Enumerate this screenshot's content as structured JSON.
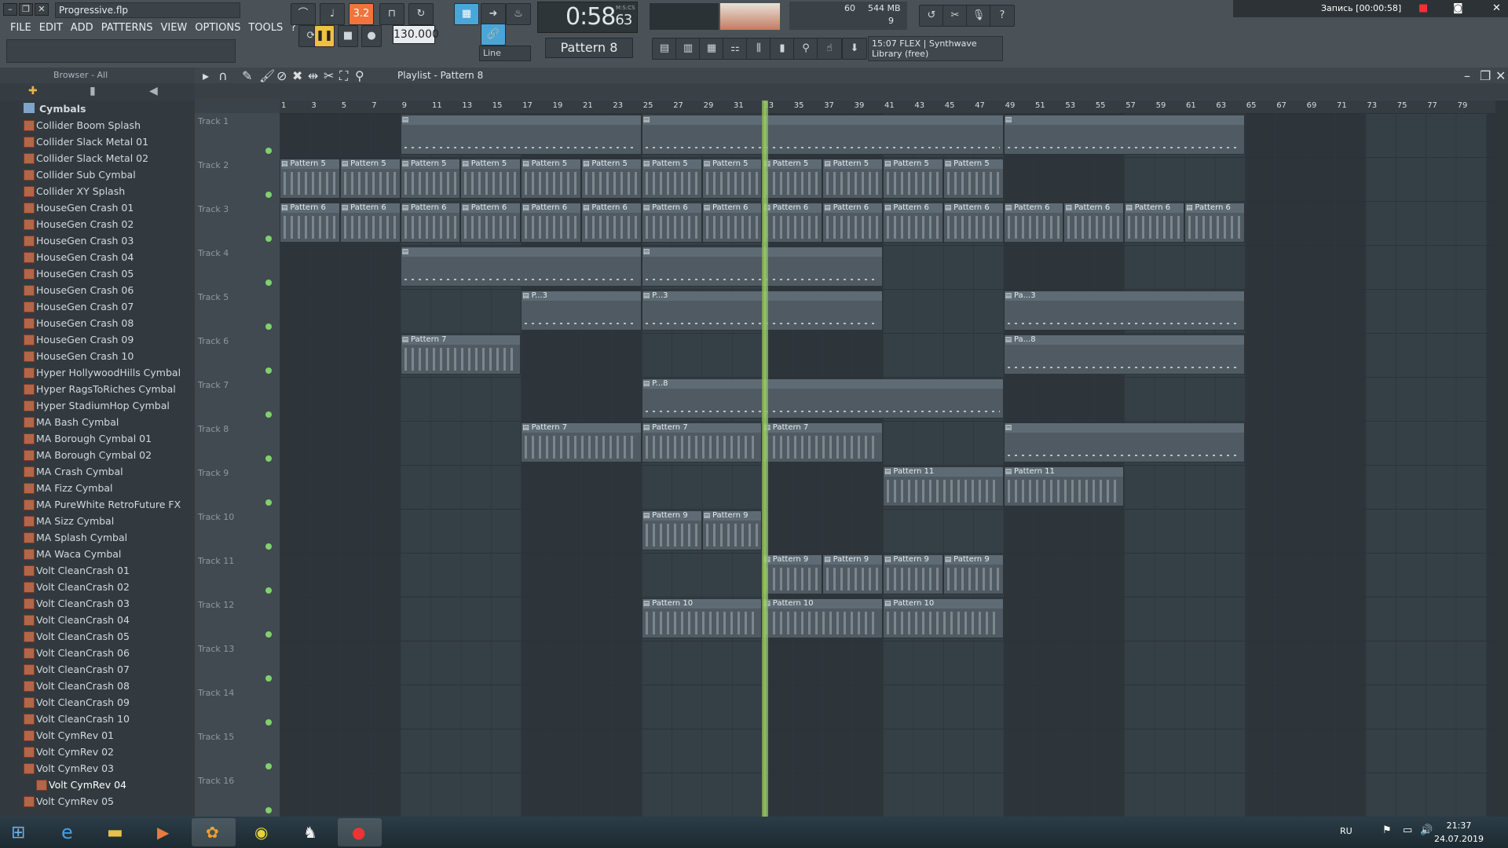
{
  "window": {
    "title": "Progressive.flp"
  },
  "menu": [
    "FILE",
    "EDIT",
    "ADD",
    "PATTERNS",
    "VIEW",
    "OPTIONS",
    "TOOLS",
    "?"
  ],
  "transport": {
    "time": "0:58",
    "time_sub": "63",
    "time_unit": "M:S:CS",
    "bpm": "130.000",
    "snap": "Line",
    "pattern": "Pattern 8",
    "step_counter": "3.2",
    "cpu_value": "60",
    "ram": "544 MB",
    "polyphony": "9"
  },
  "hint_panel": {
    "line1": "15:07  FLEX | Synthwave",
    "line2": "Library (free)"
  },
  "recording": {
    "label": "Запись [00:00:58]"
  },
  "browser": {
    "header": "Browser - All",
    "folder": "Cymbals",
    "items": [
      "Collider Boom Splash",
      "Collider Slack Metal 01",
      "Collider Slack Metal 02",
      "Collider Sub Cymbal",
      "Collider XY Splash",
      "HouseGen Crash 01",
      "HouseGen Crash 02",
      "HouseGen Crash 03",
      "HouseGen Crash 04",
      "HouseGen Crash 05",
      "HouseGen Crash 06",
      "HouseGen Crash 07",
      "HouseGen Crash 08",
      "HouseGen Crash 09",
      "HouseGen Crash 10",
      "Hyper HollywoodHills Cymbal",
      "Hyper RagsToRiches Cymbal",
      "Hyper StadiumHop Cymbal",
      "MA Bash Cymbal",
      "MA Borough Cymbal 01",
      "MA Borough Cymbal 02",
      "MA Crash Cymbal",
      "MA Fizz Cymbal",
      "MA PureWhite RetroFuture FX",
      "MA Sizz Cymbal",
      "MA Splash Cymbal",
      "MA Waca Cymbal",
      "Volt CleanCrash 01",
      "Volt CleanCrash 02",
      "Volt CleanCrash 03",
      "Volt CleanCrash 04",
      "Volt CleanCrash 05",
      "Volt CleanCrash 06",
      "Volt CleanCrash 07",
      "Volt CleanCrash 08",
      "Volt CleanCrash 09",
      "Volt CleanCrash 10",
      "Volt CymRev 01",
      "Volt CymRev 02",
      "Volt CymRev 03",
      "Volt CymRev 04",
      "Volt CymRev 05"
    ],
    "selected": "Volt CymRev 04"
  },
  "playlist": {
    "title": "Playlist - Pattern 8",
    "ruler": [
      "1",
      "3",
      "5",
      "7",
      "9",
      "11",
      "13",
      "15",
      "17",
      "19",
      "21",
      "23",
      "25",
      "27",
      "29",
      "31",
      "33",
      "35",
      "37",
      "39",
      "41",
      "43",
      "45",
      "47",
      "49",
      "51",
      "53",
      "55",
      "57",
      "59",
      "61",
      "63",
      "65",
      "67",
      "69",
      "71",
      "73",
      "75",
      "77",
      "79"
    ],
    "tracks": [
      "Track 1",
      "Track 2",
      "Track 3",
      "Track 4",
      "Track 5",
      "Track 6",
      "Track 7",
      "Track 8",
      "Track 9",
      "Track 10",
      "Track 11",
      "Track 12",
      "Track 13",
      "Track 14",
      "Track 15",
      "Track 16"
    ],
    "playhead_bar": 33,
    "clips": [
      {
        "track": 0,
        "start": 9,
        "len": 16,
        "label": "",
        "thin": true
      },
      {
        "track": 0,
        "start": 25,
        "len": 24,
        "label": "",
        "thin": true
      },
      {
        "track": 0,
        "start": 49,
        "len": 16,
        "label": "",
        "thin": true
      },
      {
        "track": 1,
        "start": 1,
        "len": 4,
        "label": "Pattern 5"
      },
      {
        "track": 1,
        "start": 5,
        "len": 4,
        "label": "Pattern 5"
      },
      {
        "track": 1,
        "start": 9,
        "len": 4,
        "label": "Pattern 5"
      },
      {
        "track": 1,
        "start": 13,
        "len": 4,
        "label": "Pattern 5"
      },
      {
        "track": 1,
        "start": 17,
        "len": 4,
        "label": "Pattern 5"
      },
      {
        "track": 1,
        "start": 21,
        "len": 4,
        "label": "Pattern 5"
      },
      {
        "track": 1,
        "start": 25,
        "len": 4,
        "label": "Pattern 5"
      },
      {
        "track": 1,
        "start": 29,
        "len": 4,
        "label": "Pattern 5"
      },
      {
        "track": 1,
        "start": 33,
        "len": 4,
        "label": "Pattern 5"
      },
      {
        "track": 1,
        "start": 37,
        "len": 4,
        "label": "Pattern 5"
      },
      {
        "track": 1,
        "start": 41,
        "len": 4,
        "label": "Pattern 5"
      },
      {
        "track": 1,
        "start": 45,
        "len": 4,
        "label": "Pattern 5"
      },
      {
        "track": 2,
        "start": 1,
        "len": 4,
        "label": "Pattern 6"
      },
      {
        "track": 2,
        "start": 5,
        "len": 4,
        "label": "Pattern 6"
      },
      {
        "track": 2,
        "start": 9,
        "len": 4,
        "label": "Pattern 6"
      },
      {
        "track": 2,
        "start": 13,
        "len": 4,
        "label": "Pattern 6"
      },
      {
        "track": 2,
        "start": 17,
        "len": 4,
        "label": "Pattern 6"
      },
      {
        "track": 2,
        "start": 21,
        "len": 4,
        "label": "Pattern 6"
      },
      {
        "track": 2,
        "start": 25,
        "len": 4,
        "label": "Pattern 6"
      },
      {
        "track": 2,
        "start": 29,
        "len": 4,
        "label": "Pattern 6"
      },
      {
        "track": 2,
        "start": 33,
        "len": 4,
        "label": "Pattern 6"
      },
      {
        "track": 2,
        "start": 37,
        "len": 4,
        "label": "Pattern 6"
      },
      {
        "track": 2,
        "start": 41,
        "len": 4,
        "label": "Pattern 6"
      },
      {
        "track": 2,
        "start": 45,
        "len": 4,
        "label": "Pattern 6"
      },
      {
        "track": 2,
        "start": 49,
        "len": 4,
        "label": "Pattern 6"
      },
      {
        "track": 2,
        "start": 53,
        "len": 4,
        "label": "Pattern 6"
      },
      {
        "track": 2,
        "start": 57,
        "len": 4,
        "label": "Pattern 6"
      },
      {
        "track": 2,
        "start": 61,
        "len": 4,
        "label": "Pattern 6"
      },
      {
        "track": 3,
        "start": 9,
        "len": 16,
        "label": "",
        "thin": true
      },
      {
        "track": 3,
        "start": 25,
        "len": 16,
        "label": "",
        "thin": true
      },
      {
        "track": 4,
        "start": 17,
        "len": 8,
        "label": "P...3",
        "thin": true
      },
      {
        "track": 4,
        "start": 25,
        "len": 16,
        "label": "P...3",
        "thin": true
      },
      {
        "track": 4,
        "start": 49,
        "len": 16,
        "label": "Pa...3",
        "thin": true
      },
      {
        "track": 5,
        "start": 9,
        "len": 8,
        "label": "Pattern 7"
      },
      {
        "track": 5,
        "start": 49,
        "len": 16,
        "label": "Pa...8",
        "thin": true
      },
      {
        "track": 6,
        "start": 25,
        "len": 24,
        "label": "P...8",
        "thin": true
      },
      {
        "track": 7,
        "start": 17,
        "len": 8,
        "label": "Pattern 7"
      },
      {
        "track": 7,
        "start": 25,
        "len": 8,
        "label": "Pattern 7"
      },
      {
        "track": 7,
        "start": 33,
        "len": 8,
        "label": "Pattern 7"
      },
      {
        "track": 7,
        "start": 49,
        "len": 16,
        "label": "",
        "thin": true
      },
      {
        "track": 8,
        "start": 41,
        "len": 8,
        "label": "Pattern 11"
      },
      {
        "track": 8,
        "start": 49,
        "len": 8,
        "label": "Pattern 11"
      },
      {
        "track": 9,
        "start": 25,
        "len": 4,
        "label": "Pattern 9"
      },
      {
        "track": 9,
        "start": 29,
        "len": 4,
        "label": "Pattern 9"
      },
      {
        "track": 10,
        "start": 33,
        "len": 4,
        "label": "Pattern 9"
      },
      {
        "track": 10,
        "start": 37,
        "len": 4,
        "label": "Pattern 9"
      },
      {
        "track": 10,
        "start": 41,
        "len": 4,
        "label": "Pattern 9"
      },
      {
        "track": 10,
        "start": 45,
        "len": 4,
        "label": "Pattern 9"
      },
      {
        "track": 11,
        "start": 25,
        "len": 8,
        "label": "Pattern 10"
      },
      {
        "track": 11,
        "start": 33,
        "len": 8,
        "label": "Pattern 10"
      },
      {
        "track": 11,
        "start": 41,
        "len": 8,
        "label": "Pattern 10"
      }
    ]
  },
  "taskbar": {
    "lang": "RU",
    "time": "21:37",
    "date": "24.07.2019"
  },
  "colors": {
    "accent": "#f0743b",
    "blue": "#4aa6d8",
    "playhead": "#a6d86a"
  }
}
